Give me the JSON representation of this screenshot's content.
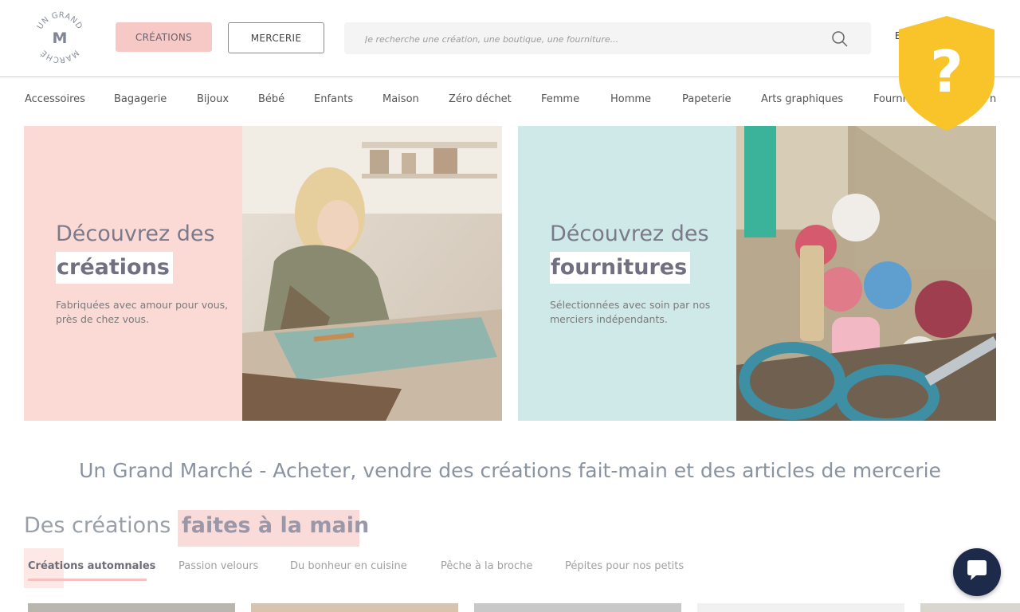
{
  "header": {
    "logo_top": "UN GRAND",
    "logo_mid": "M",
    "logo_bottom": "MARCHÉ",
    "btn_creations": "CRÉATIONS",
    "btn_mercerie": "MERCERIE",
    "search_placeholder": "Je recherche une création, une boutique, une fourniture...",
    "right_text": "E"
  },
  "nav": {
    "items": [
      "Accessoires",
      "Bagagerie",
      "Bijoux",
      "Bébé",
      "Enfants",
      "Maison",
      "Zéro déchet",
      "Femme",
      "Homme",
      "Papeterie",
      "Arts graphiques",
      "Fourni",
      "n"
    ]
  },
  "badge": {
    "symbol": "?"
  },
  "hero": {
    "left": {
      "line1": "Découvrez des",
      "line2": "créations",
      "sub": "Fabriquées avec amour pour vous, près de chez vous."
    },
    "right": {
      "line1": "Découvrez des",
      "line2": "fournitures",
      "sub": "Sélectionnées avec soin par nos merciers indépendants."
    }
  },
  "headline": "Un Grand Marché - Acheter, vendre des créations fait-main et des articles de mercerie",
  "section": {
    "title_plain": "Des créations",
    "title_highlight": "faites à la main",
    "tabs": [
      "Créations automnales",
      "Passion velours",
      "Du bonheur en cuisine",
      "Pêche à la broche",
      "Pépites pour nos petits"
    ]
  },
  "colors": {
    "pink": "#fbdad6",
    "teal": "#cfe8e8",
    "accent_pink": "#f7c9c6",
    "badge_yellow": "#f9c42a",
    "chat_navy": "#1e2a4a"
  }
}
